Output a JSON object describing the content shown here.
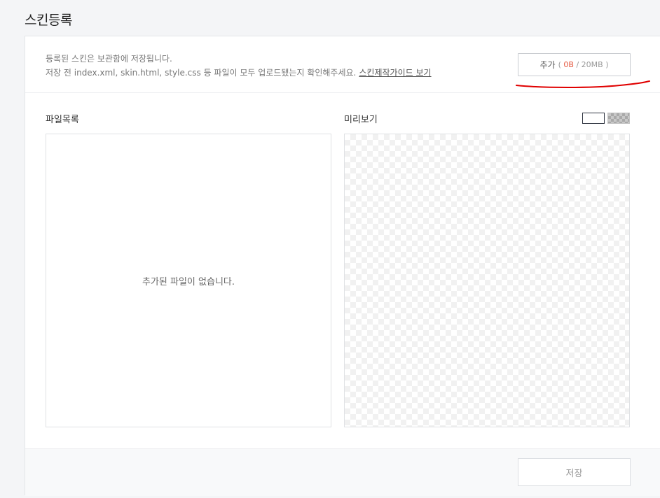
{
  "page": {
    "title": "스킨등록"
  },
  "info": {
    "line1": "등록된 스킨은 보관함에 저장됩니다.",
    "line2": "저장 전 index.xml, skin.html, style.css 등 파일이 모두 업로드됐는지 확인해주세요.",
    "guide_link": "스킨제작가이드 보기"
  },
  "add_button": {
    "label": "추가",
    "quota_open": "(",
    "used": "0B",
    "separator": "/",
    "limit": "20MB",
    "quota_close": ")"
  },
  "file_list": {
    "title": "파일목록",
    "empty_message": "추가된 파일이 없습니다."
  },
  "preview": {
    "title": "미리보기",
    "toggles": [
      "white-background-icon",
      "checker-background-icon"
    ]
  },
  "footer": {
    "save_label": "저장"
  },
  "colors": {
    "quota_used": "#e4553c",
    "annotation_mark": "#e00000",
    "page_background": "#f4f5f7"
  }
}
